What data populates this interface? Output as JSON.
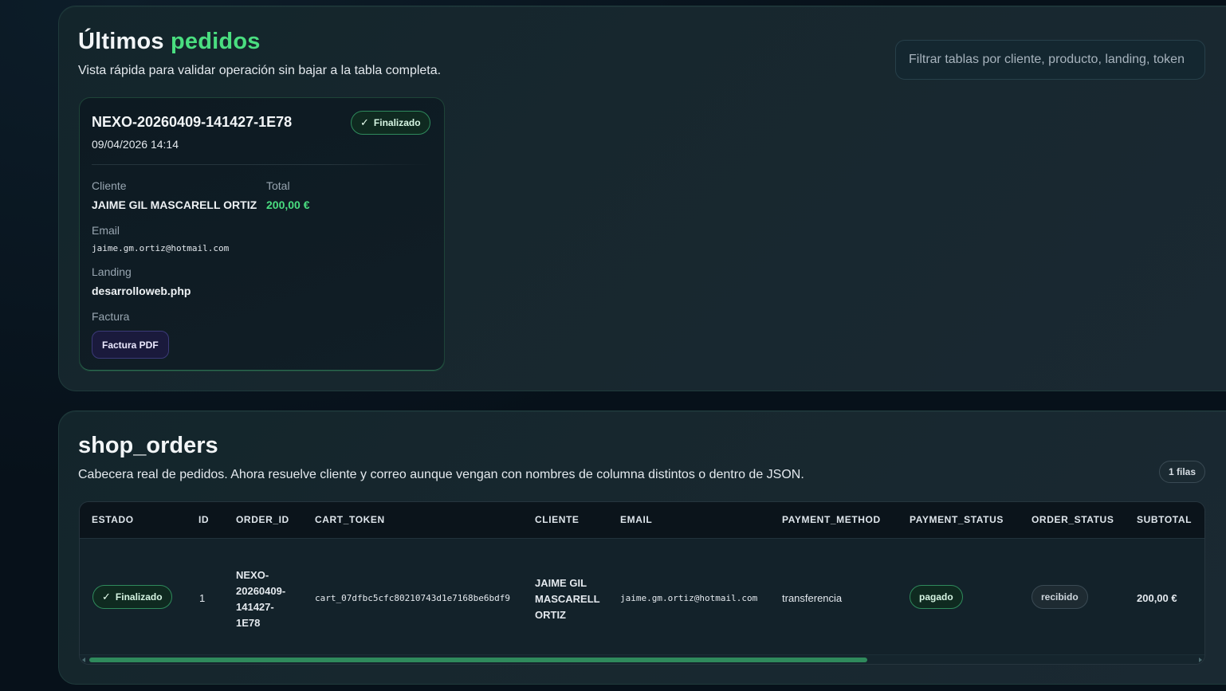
{
  "recent": {
    "title_main": "Últimos",
    "title_accent": "pedidos",
    "subtitle": "Vista rápida para validar operación sin bajar a la tabla completa.",
    "filter_placeholder": "Filtrar tablas por cliente, producto, landing, token",
    "card": {
      "order_id": "NEXO-20260409-141427-1E78",
      "date": "09/04/2026 14:14",
      "status_label": "Finalizado",
      "cliente_label": "Cliente",
      "cliente_value": "JAIME GIL MASCARELL ORTIZ",
      "total_label": "Total",
      "total_value": "200,00 €",
      "email_label": "Email",
      "email_value": "jaime.gm.ortiz@hotmail.com",
      "landing_label": "Landing",
      "landing_value": "desarrolloweb.php",
      "factura_label": "Factura",
      "factura_button": "Factura PDF"
    }
  },
  "shop_orders": {
    "title": "shop_orders",
    "subtitle": "Cabecera real de pedidos. Ahora resuelve cliente y correo aunque vengan con nombres de columna distintos o dentro de JSON.",
    "rows_badge": "1 filas",
    "columns": [
      "ESTADO",
      "ID",
      "ORDER_ID",
      "CART_TOKEN",
      "CLIENTE",
      "EMAIL",
      "PAYMENT_METHOD",
      "PAYMENT_STATUS",
      "ORDER_STATUS",
      "SUBTOTAL"
    ],
    "rows": [
      {
        "estado": "Finalizado",
        "id": "1",
        "order_id_lines": [
          "NEXO-",
          "20260409-",
          "141427-",
          "1E78"
        ],
        "cart_token": "cart_07dfbc5cfc80210743d1e7168be6bdf9",
        "cliente_lines": [
          "JAIME GIL",
          "MASCARELL",
          "ORTIZ"
        ],
        "email": "jaime.gm.ortiz@hotmail.com",
        "payment_method": "transferencia",
        "payment_status": "pagado",
        "order_status": "recibido",
        "subtotal": "200,00 €"
      }
    ]
  },
  "colors": {
    "accent_green": "#4ade80",
    "badge_green_border": "#2f8a5c",
    "pdf_button_bg": "#1a1a3c",
    "background": "#07111a"
  },
  "icons": {
    "check": "check-icon"
  }
}
